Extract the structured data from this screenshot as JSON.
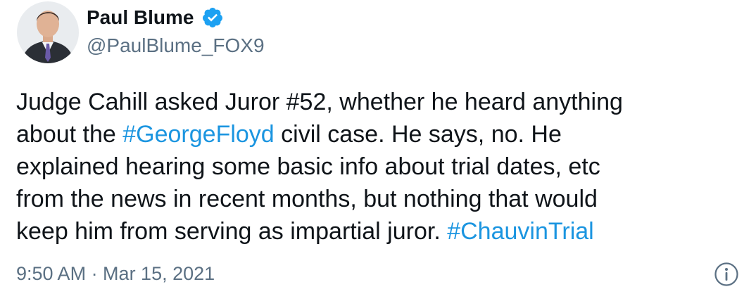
{
  "author": {
    "display_name": "Paul Blume",
    "handle": "@PaulBlume_FOX9",
    "verified_icon": "verified-badge-icon",
    "avatar": "avatar-photo"
  },
  "tweet": {
    "line1": "Judge Cahill asked Juror #52, whether he heard anything",
    "line2_pre": "about the ",
    "line2_tag": "#GeorgeFloyd",
    "line2_post": " civil case. He says, no. He",
    "line3": "explained hearing some basic info about trial dates, etc",
    "line4": "from the news in recent months, but nothing that would",
    "line5_pre": "keep him from serving as impartial juror. ",
    "line5_tag": "#ChauvinTrial"
  },
  "meta": {
    "timestamp": "9:50 AM · Mar 15, 2021",
    "info_icon": "info-icon"
  },
  "colors": {
    "link": "#1b95e0",
    "secondary_text": "#5b7083",
    "primary_text": "#0f1419",
    "verified": "#1da1f2"
  }
}
